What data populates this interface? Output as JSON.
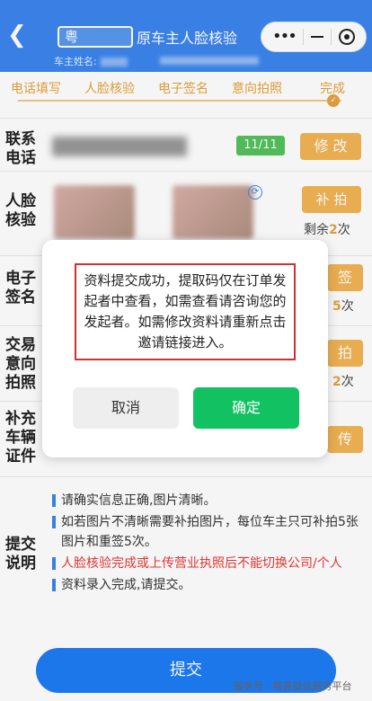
{
  "header": {
    "plate_prefix": "粤",
    "title": "原车主人脸核验",
    "owner_label": "车主姓名:"
  },
  "steps": [
    "电话填写",
    "人脸核验",
    "电子签名",
    "意向拍照",
    "完成"
  ],
  "rows": {
    "phone": {
      "label": "联系电话",
      "count": "11/11",
      "button": "修 改"
    },
    "face": {
      "label": "人脸核验",
      "button": "补 拍",
      "remain_prefix": "剩余",
      "remain_num": "2",
      "remain_suffix": "次"
    },
    "sign": {
      "label": "电子签名",
      "button": "签",
      "remain_num": "5",
      "remain_suffix": "次"
    },
    "photo": {
      "label": "交易意向拍照",
      "button": "拍",
      "remain_num": "2",
      "remain_suffix": "次"
    },
    "cert": {
      "label": "补充车辆证件",
      "button": "传"
    },
    "instr": {
      "label": "提交说明"
    }
  },
  "instructions": [
    {
      "text": "请确实信息正确,图片清晰。",
      "red": false
    },
    {
      "text": "如若图片不清晰需要补拍图片，每位车主只可补拍5张图片和重签5次。",
      "red": false
    },
    {
      "text": "人脸核验完成或上传营业执照后不能切换公司/个人",
      "red": true
    },
    {
      "text": "资料录入完成,请提交。",
      "red": false
    }
  ],
  "submit_label": "提交",
  "watermark": "服务号 · 唯普联信服务平台",
  "modal": {
    "message": "资料提交成功，提取码仅在订单发起者中查看，如需查看请咨询您的发起者。如需修改资料请重新点击邀请链接进入。",
    "cancel": "取消",
    "confirm": "确定"
  },
  "colors": {
    "header": "#3d86ee",
    "accent": "#e6a23c",
    "confirm": "#12c162",
    "submit": "#1e7cf5"
  }
}
